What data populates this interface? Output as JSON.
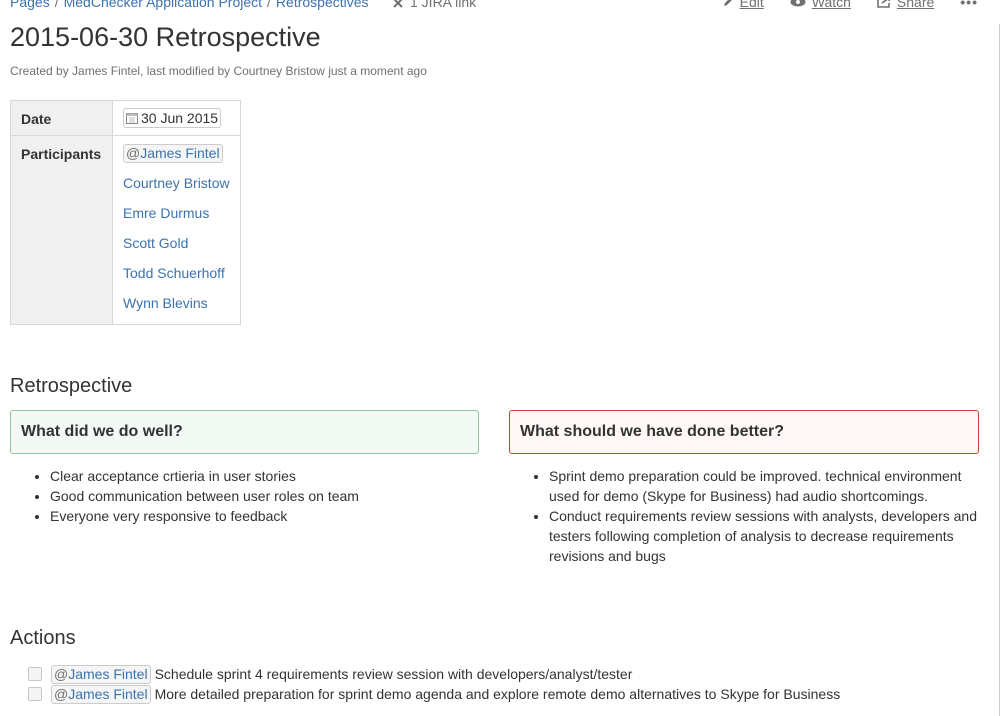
{
  "breadcrumbs": [
    "Pages",
    "MedChecker Application Project",
    "Retrospectives"
  ],
  "jira_link": "1 JIRA link",
  "page_actions": {
    "edit": "Edit",
    "watch": "Watch",
    "share": "Share",
    "more": "•••"
  },
  "page": {
    "title": "2015-06-30 Retrospective",
    "byline": {
      "created_prefix": "Created by",
      "creator": "James Fintel",
      "modified_prefix": ", last modified by",
      "modifier": "Courtney Bristow",
      "time": "just a moment ago"
    }
  },
  "details": {
    "date_label": "Date",
    "date_value": "30 Jun 2015",
    "participants_label": "Participants",
    "participants": [
      "James Fintel",
      "Courtney Bristow",
      "Emre Durmus",
      "Scott Gold",
      "Todd Schuerhoff",
      "Wynn Blevins"
    ]
  },
  "retrospective": {
    "heading": "Retrospective",
    "well": {
      "title": "What did we do well?",
      "items": [
        "Clear acceptance crtieria in user stories",
        "Good communication between user roles on team",
        "Everyone very responsive to feedback"
      ]
    },
    "better": {
      "title": "What should we have done better?",
      "items": [
        "Sprint demo preparation could be improved.  technical environment used for demo (Skype for Business) had audio shortcomings.",
        "Conduct requirements review sessions with analysts, developers and testers following completion of analysis to decrease requirements revisions and bugs"
      ]
    }
  },
  "actions": {
    "heading": "Actions",
    "tasks": [
      {
        "assignee": "James Fintel",
        "text": "Schedule sprint 4 requirements review session with developers/analyst/tester",
        "checked": false
      },
      {
        "assignee": "James Fintel",
        "text": "More detailed preparation for sprint demo agenda and explore remote demo alternatives to Skype for Business",
        "checked": false
      }
    ]
  },
  "colors": {
    "link": "#3b73af",
    "good_panel_bg": "#f3f9f4",
    "good_panel_border": "#91c89c",
    "bad_panel_bg": "#fff8f7",
    "bad_panel_border": "#d04437"
  },
  "icons": {
    "jira": "jira-link-icon",
    "edit": "pencil-icon",
    "watch": "eye-icon",
    "share": "share-icon",
    "date": "calendar-icon"
  }
}
